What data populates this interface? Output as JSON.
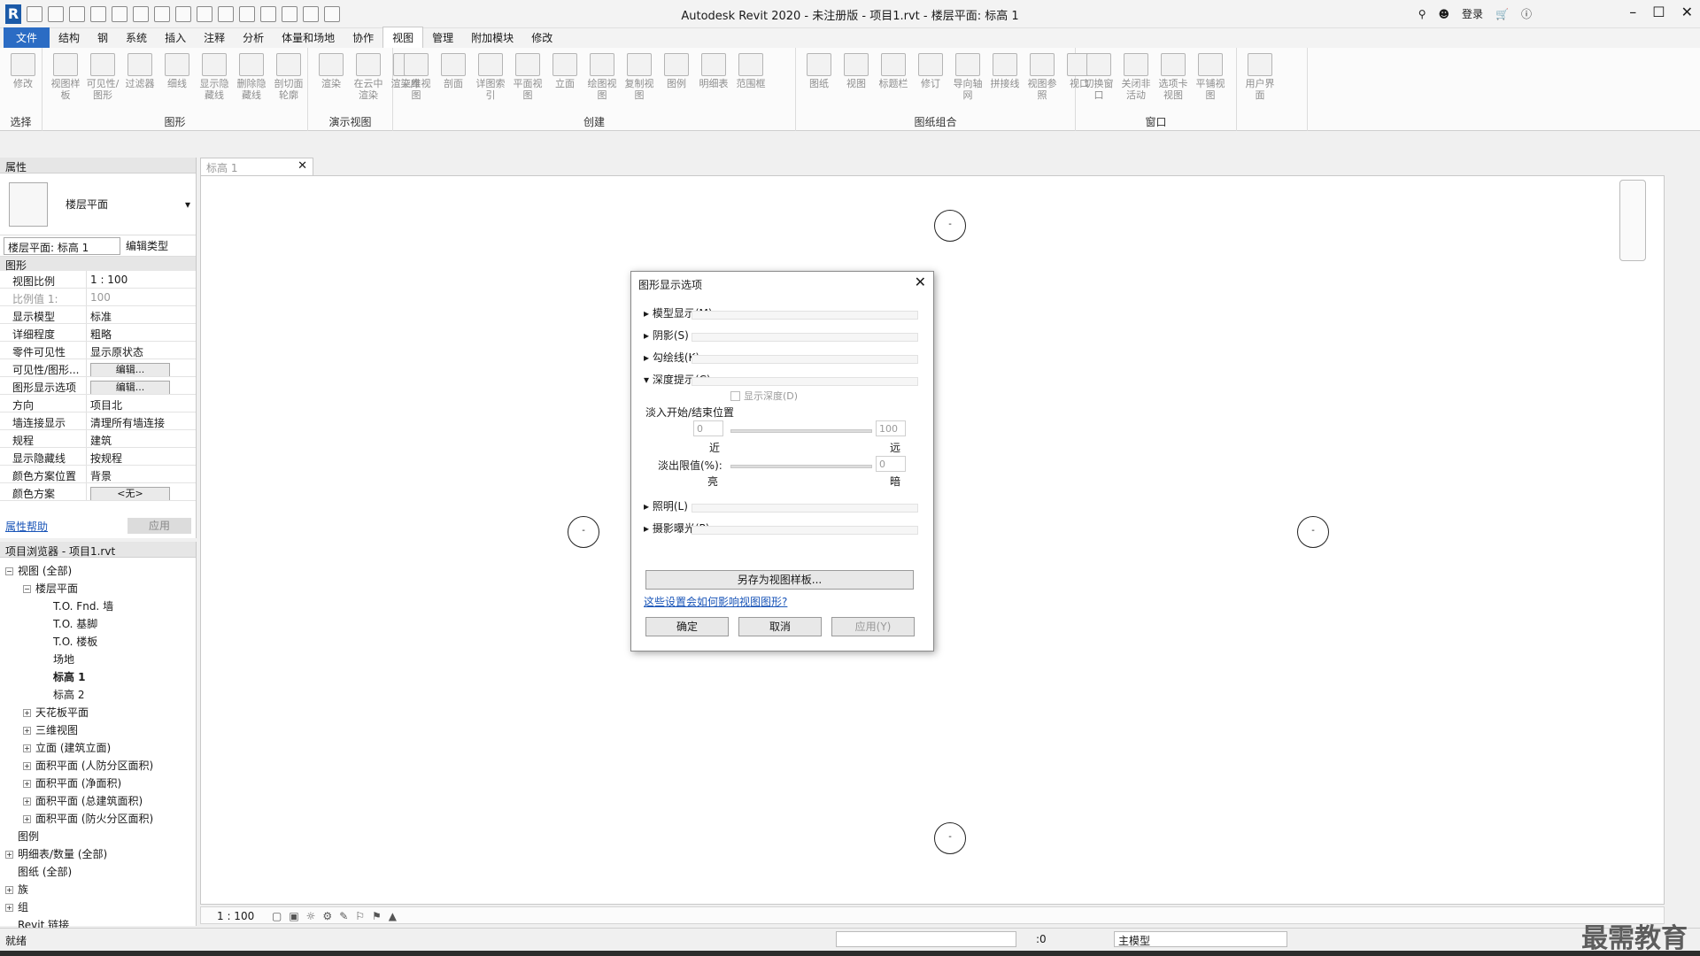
{
  "window": {
    "title": "Autodesk Revit 2020 - 未注册版 - 项目1.rvt - 楼层平面: 标高 1",
    "login": "登录"
  },
  "tabs": [
    "文件",
    "结构",
    "钢",
    "系统",
    "插入",
    "注释",
    "分析",
    "体量和场地",
    "协作",
    "视图",
    "管理",
    "附加模块",
    "修改"
  ],
  "active_tab": "视图",
  "ribbon": {
    "groups": [
      {
        "label": "选择",
        "buttons": [
          "修改"
        ]
      },
      {
        "label": "图形",
        "buttons": [
          "视图样板",
          "可见性/图形",
          "过滤器",
          "细线",
          "显示隐藏线",
          "删除隐藏线",
          "剖切面轮廓"
        ]
      },
      {
        "label": "演示视图",
        "buttons": [
          "渲染",
          "在云中渲染",
          "渲染库"
        ]
      },
      {
        "label": "创建",
        "buttons": [
          "三维视图",
          "剖面",
          "详图索引",
          "平面视图",
          "立面",
          "绘图视图",
          "复制视图",
          "图例",
          "明细表",
          "范围框"
        ]
      },
      {
        "label": "图纸组合",
        "buttons": [
          "图纸",
          "视图",
          "标题栏",
          "修订",
          "导向轴网",
          "拼接线",
          "视图参照",
          "视口"
        ]
      },
      {
        "label": "窗口",
        "buttons": [
          "切换窗口",
          "关闭非活动",
          "选项卡视图",
          "平铺视图"
        ]
      },
      {
        "label": "",
        "buttons": [
          "用户界面"
        ]
      }
    ]
  },
  "properties": {
    "header": "属性",
    "type_name": "楼层平面",
    "view_selector": "楼层平面: 标高 1",
    "edit_type": "编辑类型",
    "section": "图形",
    "rows": [
      {
        "k": "视图比例",
        "v": "1 : 100"
      },
      {
        "k": "比例值 1:",
        "v": "100"
      },
      {
        "k": "显示模型",
        "v": "标准"
      },
      {
        "k": "详细程度",
        "v": "粗略"
      },
      {
        "k": "零件可见性",
        "v": "显示原状态"
      },
      {
        "k": "可见性/图形...",
        "v": "编辑..."
      },
      {
        "k": "图形显示选项",
        "v": "编辑..."
      },
      {
        "k": "方向",
        "v": "项目北"
      },
      {
        "k": "墙连接显示",
        "v": "清理所有墙连接"
      },
      {
        "k": "规程",
        "v": "建筑"
      },
      {
        "k": "显示隐藏线",
        "v": "按规程"
      },
      {
        "k": "颜色方案位置",
        "v": "背景"
      },
      {
        "k": "颜色方案",
        "v": "<无>"
      }
    ],
    "help": "属性帮助",
    "apply": "应用"
  },
  "browser": {
    "header": "项目浏览器 - 项目1.rvt",
    "items": [
      {
        "t": "视图 (全部)",
        "lvl": 0,
        "tog": "-"
      },
      {
        "t": "楼层平面",
        "lvl": 1,
        "tog": "-"
      },
      {
        "t": "T.O. Fnd. 墙",
        "lvl": 2
      },
      {
        "t": "T.O. 基脚",
        "lvl": 2
      },
      {
        "t": "T.O. 楼板",
        "lvl": 2
      },
      {
        "t": "场地",
        "lvl": 2
      },
      {
        "t": "标高 1",
        "lvl": 2,
        "bold": true
      },
      {
        "t": "标高 2",
        "lvl": 2
      },
      {
        "t": "天花板平面",
        "lvl": 1,
        "tog": "+"
      },
      {
        "t": "三维视图",
        "lvl": 1,
        "tog": "+"
      },
      {
        "t": "立面 (建筑立面)",
        "lvl": 1,
        "tog": "+"
      },
      {
        "t": "面积平面 (人防分区面积)",
        "lvl": 1,
        "tog": "+"
      },
      {
        "t": "面积平面 (净面积)",
        "lvl": 1,
        "tog": "+"
      },
      {
        "t": "面积平面 (总建筑面积)",
        "lvl": 1,
        "tog": "+"
      },
      {
        "t": "面积平面 (防火分区面积)",
        "lvl": 1,
        "tog": "+"
      },
      {
        "t": "图例",
        "lvl": 0
      },
      {
        "t": "明细表/数量 (全部)",
        "lvl": 0,
        "tog": "+"
      },
      {
        "t": "图纸 (全部)",
        "lvl": 0
      },
      {
        "t": "族",
        "lvl": 0,
        "tog": "+"
      },
      {
        "t": "组",
        "lvl": 0,
        "tog": "+"
      },
      {
        "t": "Revit 链接",
        "lvl": 0
      }
    ]
  },
  "view_tab": "标高 1",
  "dialog": {
    "title": "图形显示选项",
    "sections": [
      "模型显示(M)",
      "阴影(S)",
      "勾绘线(K)",
      "深度提示(C)",
      "照明(L)",
      "摄影曝光(P)"
    ],
    "show_depth": "显示深度(D)",
    "fade_label": "淡入开始/结束位置",
    "near_value": "0",
    "far_value": "100",
    "near": "近",
    "far": "远",
    "fade_limit": "淡出限值(%):",
    "fade_limit_value": "0",
    "light": "亮",
    "dark": "暗",
    "save_template": "另存为视图样板...",
    "link": "这些设置会如何影响视图图形?",
    "ok": "确定",
    "cancel": "取消",
    "apply": "应用(Y)"
  },
  "viewbar": {
    "scale": "1 : 100"
  },
  "status": {
    "text": "就绪",
    "coords": ":0",
    "model": "主模型"
  },
  "watermark": "最需教育"
}
